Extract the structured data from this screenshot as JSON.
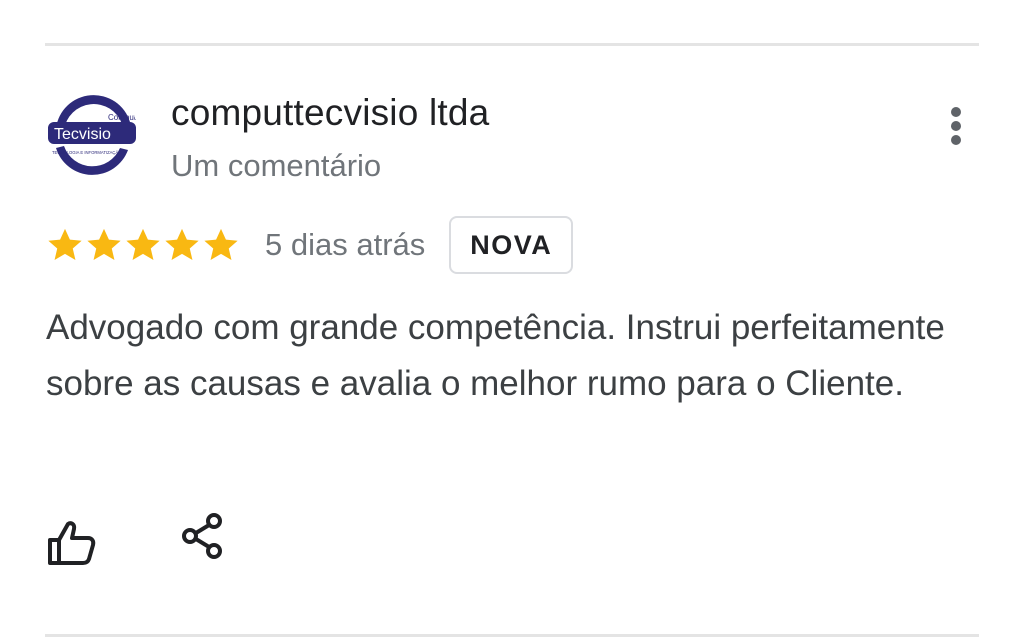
{
  "reviewer": {
    "name": "computtecvisio ltda",
    "meta": "Um comentário",
    "avatar": {
      "logo_text_main": "Tecvisio",
      "logo_text_small": "Comput",
      "logo_tagline": "TECNOLOGIA E INFORMATIZAÇÃO",
      "colors": {
        "navy": "#2d2a7a",
        "ring": "#6b64b8"
      }
    }
  },
  "review": {
    "rating": 5,
    "rating_max": 5,
    "date": "5 dias atrás",
    "badge": "NOVA",
    "text": "Advogado com grande competência. Instrui perfeitamente sobre as causas e avalia o melhor rumo para o Cliente."
  },
  "actions": {
    "like_icon": "thumb-up-icon",
    "share_icon": "share-icon",
    "more_icon": "more-vert-icon"
  },
  "colors": {
    "star": "#f9b812",
    "secondary_text": "#70757a",
    "body_text": "#3c4043",
    "divider": "#e4e4e4"
  }
}
